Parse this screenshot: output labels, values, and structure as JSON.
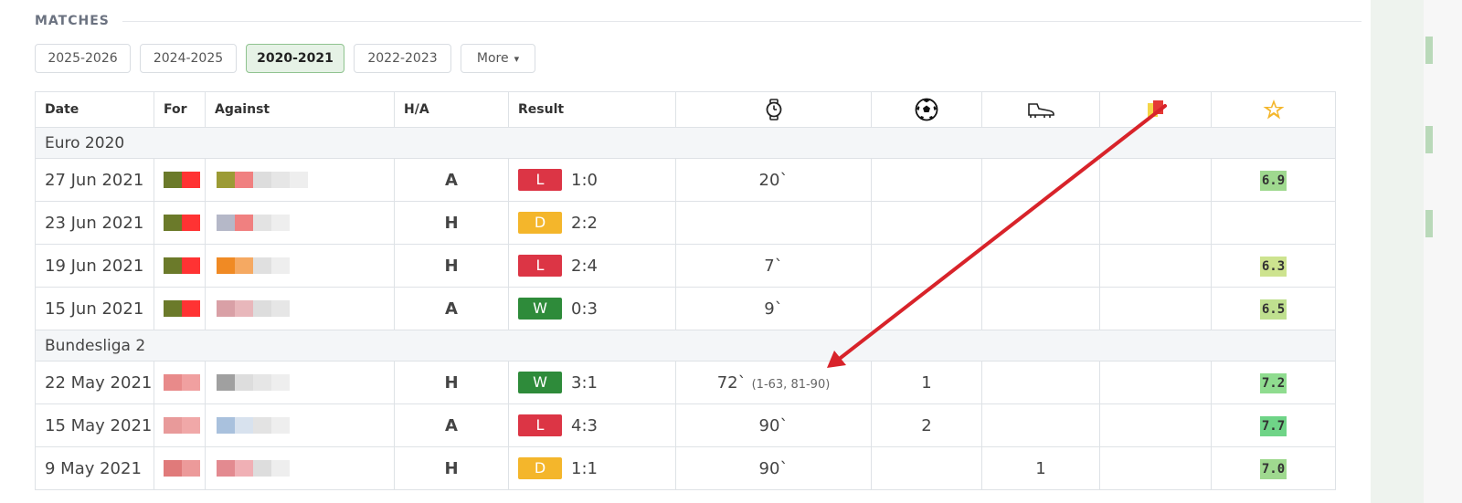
{
  "section": {
    "title": "MATCHES"
  },
  "seasons": {
    "tabs": [
      "2025-2026",
      "2024-2025",
      "2020-2021",
      "2022-2023"
    ],
    "active": "2020-2021",
    "more_label": "More",
    "more_caret": "▾"
  },
  "table": {
    "headers": {
      "date": "Date",
      "for": "For",
      "against": "Against",
      "ha": "H/A",
      "result": "Result",
      "minutes_icon": "stopwatch-icon",
      "goals_icon": "football-icon",
      "assists_icon": "boot-icon",
      "cards_icon": "cards-icon",
      "rating_icon": "star-icon"
    },
    "groups": [
      {
        "competition": "Euro 2020",
        "rows": [
          {
            "date": "27 Jun 2021",
            "ha": "A",
            "result": "L",
            "score": "1:0",
            "minutes": "20`",
            "minutes_detail": "",
            "goals": "",
            "assists": "",
            "cards": "",
            "rating": "6.9",
            "rating_color": "#9fd98f"
          },
          {
            "date": "23 Jun 2021",
            "ha": "H",
            "result": "D",
            "score": "2:2",
            "minutes": "",
            "minutes_detail": "",
            "goals": "",
            "assists": "",
            "cards": "",
            "rating": "",
            "rating_color": ""
          },
          {
            "date": "19 Jun 2021",
            "ha": "H",
            "result": "L",
            "score": "2:4",
            "minutes": "7`",
            "minutes_detail": "",
            "goals": "",
            "assists": "",
            "cards": "",
            "rating": "6.3",
            "rating_color": "#cde38f"
          },
          {
            "date": "15 Jun 2021",
            "ha": "A",
            "result": "W",
            "score": "0:3",
            "minutes": "9`",
            "minutes_detail": "",
            "goals": "",
            "assists": "",
            "cards": "",
            "rating": "6.5",
            "rating_color": "#bfe08f"
          }
        ]
      },
      {
        "competition": "Bundesliga 2",
        "rows": [
          {
            "date": "22 May 2021",
            "ha": "H",
            "result": "W",
            "score": "3:1",
            "minutes": "72`",
            "minutes_detail": "(1-63, 81-90)",
            "goals": "1",
            "assists": "",
            "cards": "",
            "rating": "7.2",
            "rating_color": "#8fdc8f"
          },
          {
            "date": "15 May 2021",
            "ha": "A",
            "result": "L",
            "score": "4:3",
            "minutes": "90`",
            "minutes_detail": "",
            "goals": "2",
            "assists": "",
            "cards": "",
            "rating": "7.7",
            "rating_color": "#6fd487"
          },
          {
            "date": "9 May 2021",
            "ha": "H",
            "result": "D",
            "score": "1:1",
            "minutes": "90`",
            "minutes_detail": "",
            "goals": "",
            "assists": "1",
            "cards": "",
            "rating": "7.0",
            "rating_color": "#9fd98f"
          }
        ]
      }
    ]
  },
  "colors": {
    "win": "#2e8b3a",
    "loss": "#dc3545",
    "draw": "#f4b62b",
    "annotation_arrow": "#d8232a",
    "active_tab_bg": "#e6f2e6"
  }
}
